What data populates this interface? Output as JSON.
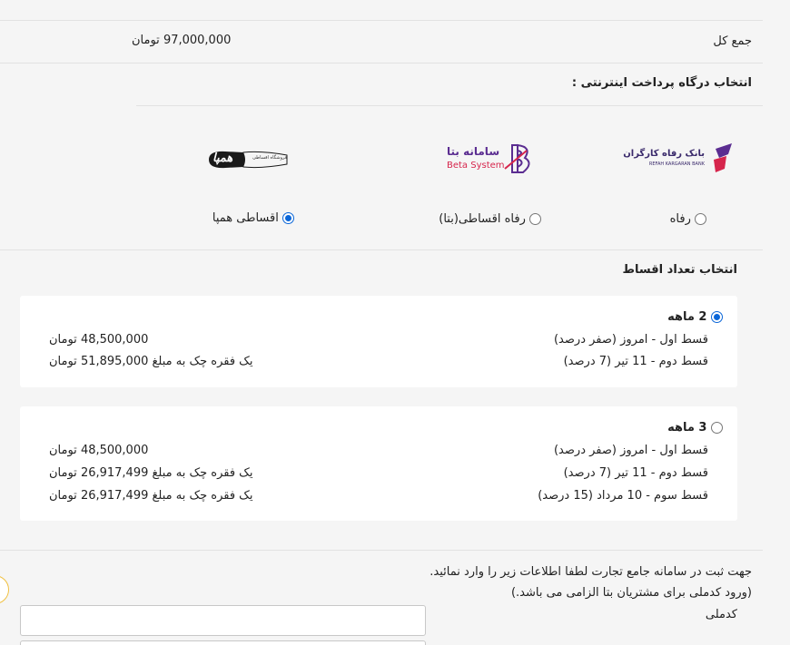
{
  "total": {
    "label": "جمع کل",
    "value": "97,000,000 تومان"
  },
  "gateway": {
    "title": "انتخاب درگاه پرداخت اینترنتی :",
    "options": [
      {
        "label": "رفاه",
        "logo_text": "بانک رفاه کارگران",
        "logo_subtext": "REFAH KARGARAN BANK",
        "selected": false
      },
      {
        "label": "رفاه اقساطی(بتا)",
        "logo_text": "سامانه بتا",
        "logo_subtext": "Beta System",
        "selected": false
      },
      {
        "label": "اقساطی همپا",
        "logo_text": "همپا",
        "logo_subtext": "فروشگاه اقساطی",
        "selected": true
      }
    ]
  },
  "installments": {
    "title": "انتخاب تعداد اقساط",
    "plans": [
      {
        "title": "2 ماهه",
        "selected": true,
        "rows": [
          {
            "desc": "قسط اول - امروز (صفر درصد)",
            "amount": "48,500,000 تومان"
          },
          {
            "desc": "قسط دوم - 11 تیر (7 درصد)",
            "amount": "یک فقره چک به مبلغ 51,895,000 تومان"
          }
        ]
      },
      {
        "title": "3 ماهه",
        "selected": false,
        "rows": [
          {
            "desc": "قسط اول - امروز (صفر درصد)",
            "amount": "48,500,000 تومان"
          },
          {
            "desc": "قسط دوم - 11 تیر (7 درصد)",
            "amount": "یک فقره چک به مبلغ 26,917,499 تومان"
          },
          {
            "desc": "قسط سوم - 10 مرداد (15 درصد)",
            "amount": "یک فقره چک به مبلغ 26,917,499 تومان"
          }
        ]
      }
    ]
  },
  "registration": {
    "note": "جهت ثبت در سامانه جامع تجارت لطفا اطلاعات زیر را وارد نمائید.",
    "subnote": "(ورود کدملی برای مشتریان بتا الزامی می باشد.)",
    "national_code_label": "کدملی",
    "national_code_value": ""
  },
  "colors": {
    "accent": "#0a66d8",
    "refah_purple": "#5b2d91",
    "beta_red": "#d6254c"
  }
}
